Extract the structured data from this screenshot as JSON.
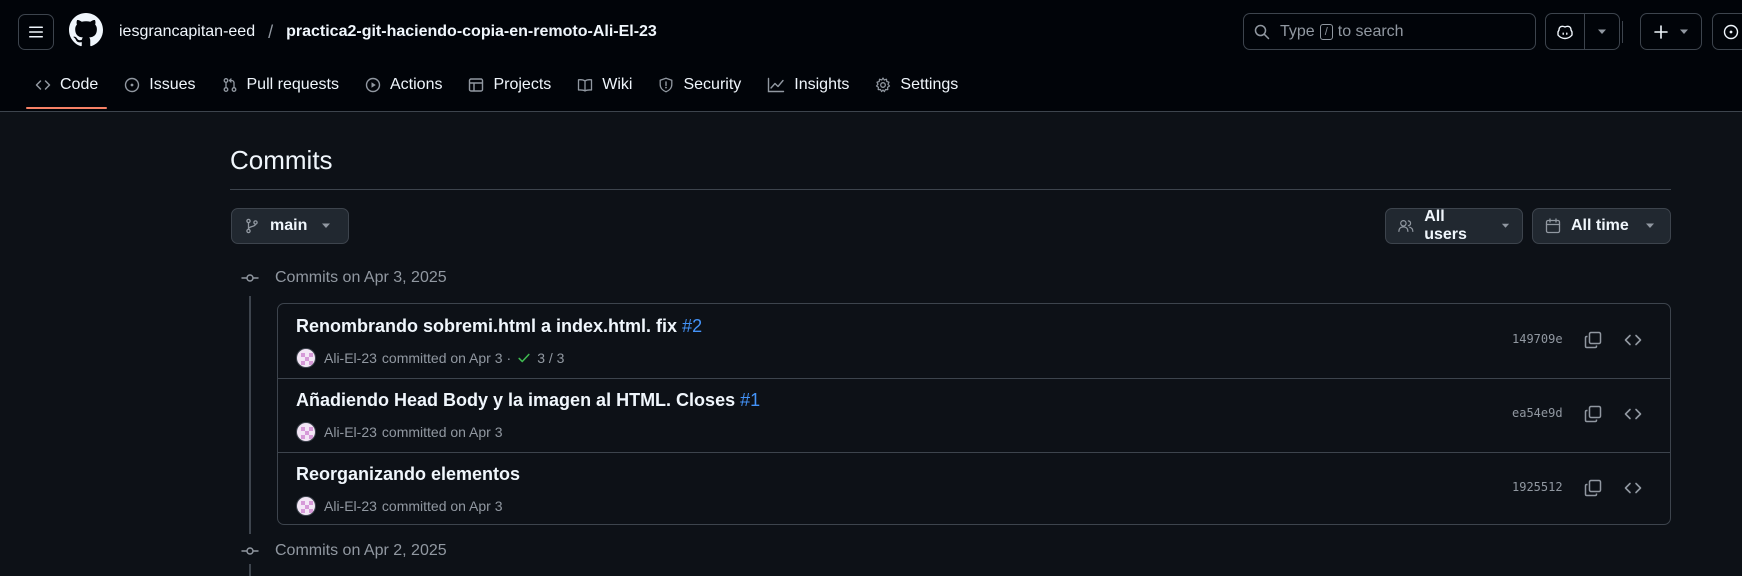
{
  "header": {
    "org": "iesgrancapitan-eed",
    "separator": "/",
    "repo": "practica2-git-haciendo-copia-en-remoto-Ali-El-23",
    "search": {
      "prefix": "Type",
      "key": "/",
      "suffix": "to search"
    }
  },
  "nav": [
    {
      "label": "Code",
      "icon": "code-icon"
    },
    {
      "label": "Issues",
      "icon": "issue-opened-icon"
    },
    {
      "label": "Pull requests",
      "icon": "git-pull-request-icon"
    },
    {
      "label": "Actions",
      "icon": "play-icon"
    },
    {
      "label": "Projects",
      "icon": "table-icon"
    },
    {
      "label": "Wiki",
      "icon": "book-icon"
    },
    {
      "label": "Security",
      "icon": "shield-icon"
    },
    {
      "label": "Insights",
      "icon": "graph-icon"
    },
    {
      "label": "Settings",
      "icon": "gear-icon"
    }
  ],
  "page": {
    "title": "Commits",
    "branch": "main",
    "users_filter": "All users",
    "time_filter": "All time"
  },
  "groups": [
    {
      "heading": "Commits on Apr 3, 2025",
      "commits": [
        {
          "title": "Renombrando sobremi.html a index.html. fix",
          "ref": "#2",
          "author": "Ali-El-23",
          "meta": "committed on Apr 3",
          "separator": "·",
          "checks": "3 / 3",
          "sha": "149709e"
        },
        {
          "title": "Añadiendo Head Body y la imagen al HTML. Closes",
          "ref": "#1",
          "author": "Ali-El-23",
          "meta": "committed on Apr 3",
          "sha": "ea54e9d"
        },
        {
          "title": "Reorganizando elementos",
          "author": "Ali-El-23",
          "meta": "committed on Apr 3",
          "sha": "1925512"
        }
      ]
    },
    {
      "heading": "Commits on Apr 2, 2025"
    }
  ],
  "colors": {
    "background": "#0d1117",
    "header_background": "#010409",
    "border": "#3d444d",
    "text": "#f0f6fc",
    "muted": "#9198a1",
    "link": "#4493f8",
    "success": "#3fb950"
  }
}
